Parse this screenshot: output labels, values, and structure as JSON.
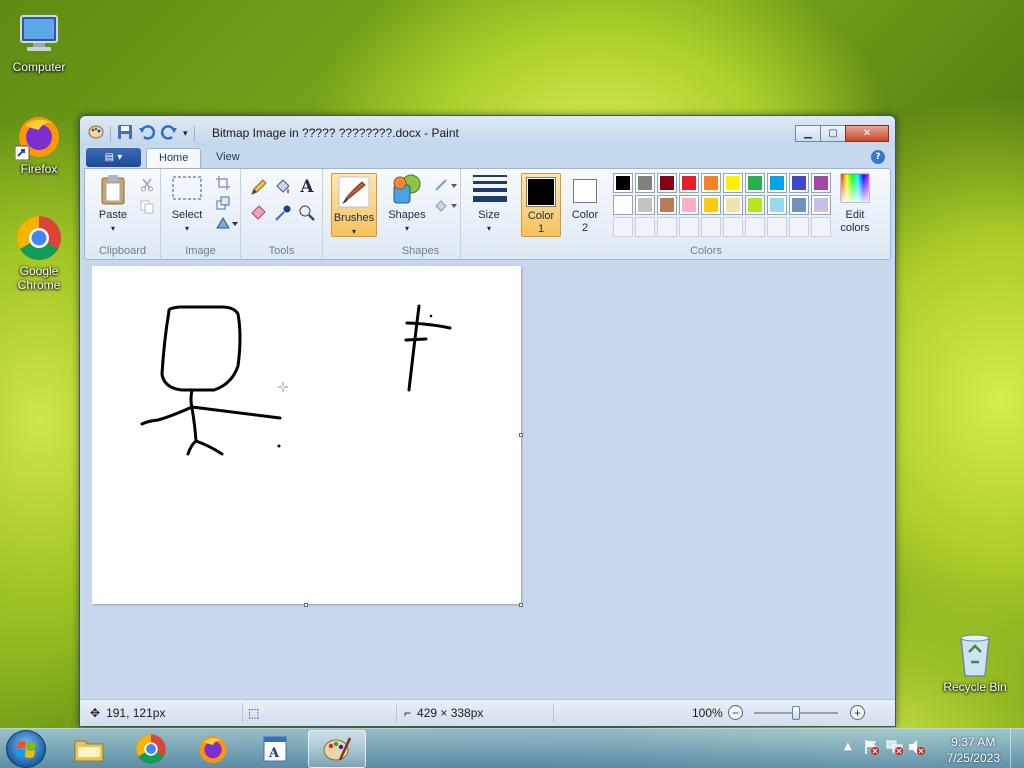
{
  "desktop": {
    "icons": [
      {
        "label": "Computer"
      },
      {
        "label": "Firefox"
      },
      {
        "label": "Google Chrome"
      },
      {
        "label": "Recycle Bin"
      }
    ]
  },
  "window": {
    "title": "Bitmap Image in ????? ????????.docx - Paint",
    "tabs": [
      {
        "label": "Home"
      },
      {
        "label": "View"
      }
    ],
    "active_tab": "Home"
  },
  "ribbon": {
    "clipboard": {
      "label": "Clipboard",
      "paste": "Paste"
    },
    "image": {
      "label": "Image",
      "select": "Select"
    },
    "tools": {
      "label": "Tools"
    },
    "brushes": {
      "label": "Brushes"
    },
    "shapes": {
      "label": "Shapes",
      "shapes_btn": "Shapes"
    },
    "size": {
      "label": "Size"
    },
    "colors": {
      "label": "Colors",
      "color1": "Color 1",
      "color2": "Color 2",
      "edit_colors": "Edit colors",
      "color1_value": "#000000",
      "color2_value": "#ffffff",
      "palette_row1": [
        "#000000",
        "#7f7f7f",
        "#880015",
        "#ed1c24",
        "#ff7f27",
        "#fff200",
        "#22b14c",
        "#00a2e8",
        "#3f48cc",
        "#a349a4"
      ],
      "palette_row2": [
        "#ffffff",
        "#c3c3c3",
        "#b97a57",
        "#ffaec9",
        "#ffc90e",
        "#efe4b0",
        "#b5e61d",
        "#99d9ea",
        "#7092be",
        "#c8bfe7"
      ]
    }
  },
  "status": {
    "cursor_pos": "191, 121px",
    "canvas_size": "429 × 338px",
    "zoom": "100%",
    "zoom_level": 1.0
  },
  "taskbar": {
    "time": "9:37 AM",
    "date": "7/25/2023",
    "apps": [
      {
        "name": "explorer-icon"
      },
      {
        "name": "chrome-icon"
      },
      {
        "name": "firefox-icon"
      },
      {
        "name": "wordpad-icon"
      },
      {
        "name": "paint-icon",
        "active": true
      }
    ]
  }
}
